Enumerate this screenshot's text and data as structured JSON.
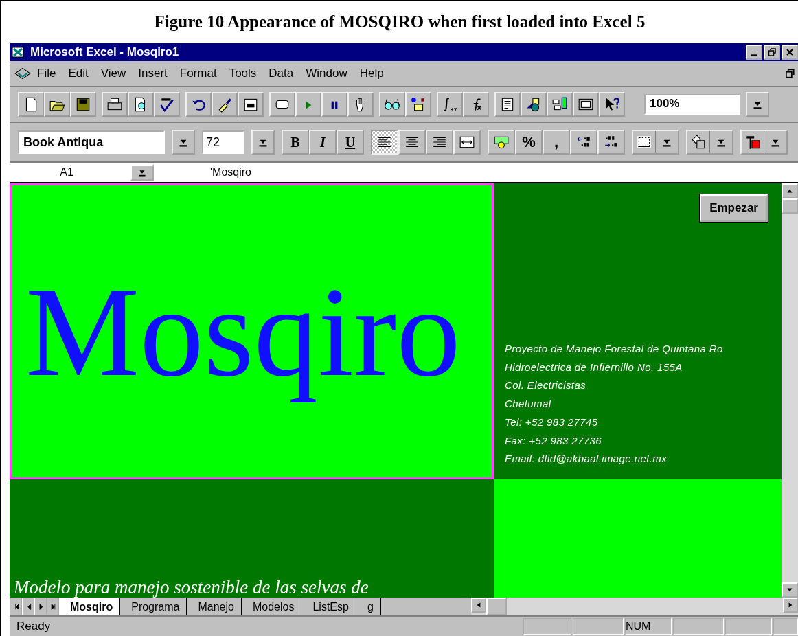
{
  "figure": {
    "caption": "Figure 10  Appearance of MOSQIRO when first loaded into Excel 5"
  },
  "window": {
    "title": "Microsoft Excel - Mosqiro1"
  },
  "menu": [
    {
      "label": "File"
    },
    {
      "label": "Edit"
    },
    {
      "label": "View"
    },
    {
      "label": "Insert"
    },
    {
      "label": "Format"
    },
    {
      "label": "Tools"
    },
    {
      "label": "Data"
    },
    {
      "label": "Window"
    },
    {
      "label": "Help"
    }
  ],
  "toolbar_standard": {
    "zoom": "100%"
  },
  "toolbar_format": {
    "font": "Book Antiqua",
    "size": "72",
    "styles": [
      {
        "label": "B",
        "selected": false
      },
      {
        "label": "I",
        "selected": false
      },
      {
        "label": "U",
        "selected": false
      }
    ],
    "alignment": [
      {
        "kind": "left",
        "selected": true
      },
      {
        "kind": "center",
        "selected": false
      },
      {
        "kind": "right",
        "selected": false
      },
      {
        "kind": "merge",
        "selected": false
      }
    ],
    "number": [
      "%",
      ","
    ]
  },
  "formula_bar": {
    "name_box": "A1",
    "formula": "'Mosqiro"
  },
  "sheet": {
    "cells": [
      {
        "kind": "title",
        "color": "#00ff00",
        "selected": true,
        "text": "Mosqiro"
      },
      {
        "kind": "info",
        "color": "#007800",
        "selected": false,
        "button": "Empezar",
        "lines": [
          "Proyecto de Manejo Forestal de Quintana Ro",
          "Hidroelectrica de Infiernillo No. 155A",
          "Col. Electricistas",
          "Chetumal",
          "Tel: +52 983 27745",
          "Fax: +52 983 27736",
          "Email: dfid@akbaal.image.net.mx"
        ]
      },
      {
        "kind": "subtitle",
        "color": "#007800",
        "selected": false,
        "text": "Modelo para manejo sostenible de las selvas de"
      },
      {
        "kind": "blank",
        "color": "#00ff00",
        "selected": false
      }
    ]
  },
  "sheet_tabs": [
    {
      "label": "Mosqiro",
      "selected": true
    },
    {
      "label": "Programa",
      "selected": false
    },
    {
      "label": "Manejo",
      "selected": false
    },
    {
      "label": "Modelos",
      "selected": false
    },
    {
      "label": "ListEsp",
      "selected": false
    },
    {
      "label": "g",
      "selected": false
    }
  ],
  "status_bar": {
    "text": "Ready",
    "indicator": "NUM"
  }
}
